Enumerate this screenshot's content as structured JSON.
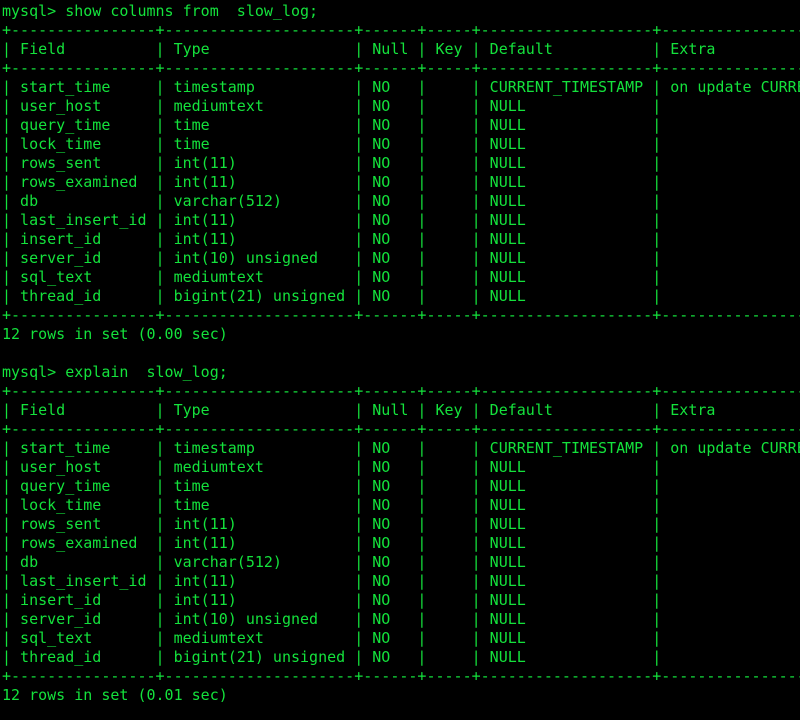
{
  "theme": {
    "foreground": "#14e23c",
    "background": "#000000"
  },
  "prompt": "mysql> ",
  "sessions": [
    {
      "command": "show columns from  slow_log;",
      "columns": [
        "Field",
        "Type",
        "Null",
        "Key",
        "Default",
        "Extra"
      ],
      "rows": [
        [
          "start_time",
          "timestamp",
          "NO",
          "",
          "CURRENT_TIMESTAMP",
          "on update CURRENT_TIMESTAMP"
        ],
        [
          "user_host",
          "mediumtext",
          "NO",
          "",
          "NULL",
          ""
        ],
        [
          "query_time",
          "time",
          "NO",
          "",
          "NULL",
          ""
        ],
        [
          "lock_time",
          "time",
          "NO",
          "",
          "NULL",
          ""
        ],
        [
          "rows_sent",
          "int(11)",
          "NO",
          "",
          "NULL",
          ""
        ],
        [
          "rows_examined",
          "int(11)",
          "NO",
          "",
          "NULL",
          ""
        ],
        [
          "db",
          "varchar(512)",
          "NO",
          "",
          "NULL",
          ""
        ],
        [
          "last_insert_id",
          "int(11)",
          "NO",
          "",
          "NULL",
          ""
        ],
        [
          "insert_id",
          "int(11)",
          "NO",
          "",
          "NULL",
          ""
        ],
        [
          "server_id",
          "int(10) unsigned",
          "NO",
          "",
          "NULL",
          ""
        ],
        [
          "sql_text",
          "mediumtext",
          "NO",
          "",
          "NULL",
          ""
        ],
        [
          "thread_id",
          "bigint(21) unsigned",
          "NO",
          "",
          "NULL",
          ""
        ]
      ],
      "footer": "12 rows in set (0.00 sec)"
    },
    {
      "command": "explain  slow_log;",
      "columns": [
        "Field",
        "Type",
        "Null",
        "Key",
        "Default",
        "Extra"
      ],
      "rows": [
        [
          "start_time",
          "timestamp",
          "NO",
          "",
          "CURRENT_TIMESTAMP",
          "on update CURRENT_TIMESTAMP"
        ],
        [
          "user_host",
          "mediumtext",
          "NO",
          "",
          "NULL",
          ""
        ],
        [
          "query_time",
          "time",
          "NO",
          "",
          "NULL",
          ""
        ],
        [
          "lock_time",
          "time",
          "NO",
          "",
          "NULL",
          ""
        ],
        [
          "rows_sent",
          "int(11)",
          "NO",
          "",
          "NULL",
          ""
        ],
        [
          "rows_examined",
          "int(11)",
          "NO",
          "",
          "NULL",
          ""
        ],
        [
          "db",
          "varchar(512)",
          "NO",
          "",
          "NULL",
          ""
        ],
        [
          "last_insert_id",
          "int(11)",
          "NO",
          "",
          "NULL",
          ""
        ],
        [
          "insert_id",
          "int(11)",
          "NO",
          "",
          "NULL",
          ""
        ],
        [
          "server_id",
          "int(10) unsigned",
          "NO",
          "",
          "NULL",
          ""
        ],
        [
          "sql_text",
          "mediumtext",
          "NO",
          "",
          "NULL",
          ""
        ],
        [
          "thread_id",
          "bigint(21) unsigned",
          "NO",
          "",
          "NULL",
          ""
        ]
      ],
      "footer": "12 rows in set (0.01 sec)"
    }
  ]
}
